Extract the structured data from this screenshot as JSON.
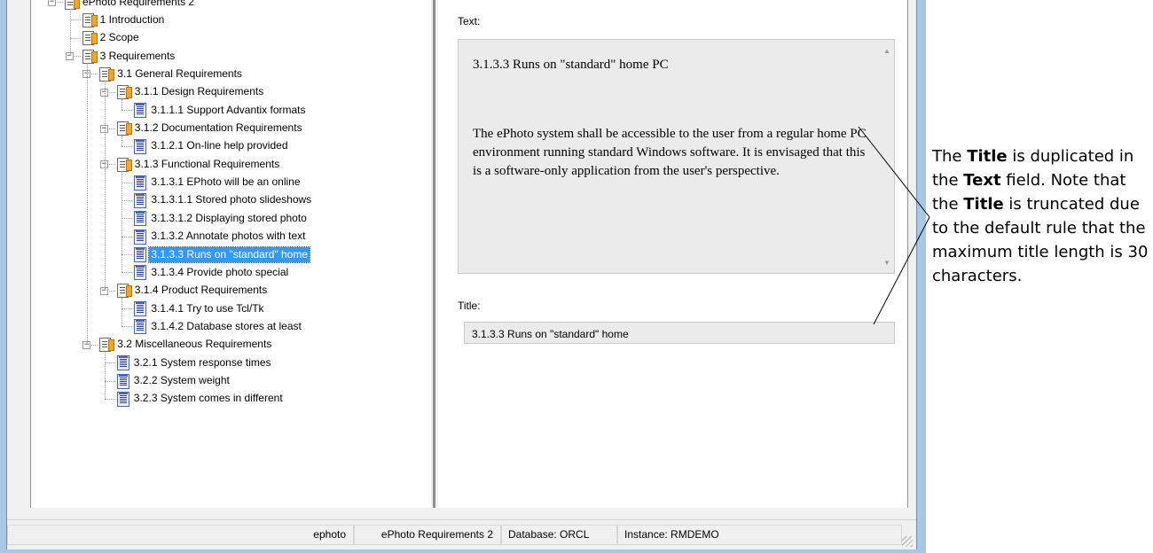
{
  "tree": {
    "items": [
      {
        "label": "ePhoto Requirements 2",
        "type": "folder"
      },
      {
        "label": "1 Introduction",
        "type": "folder"
      },
      {
        "label": "2 Scope",
        "type": "folder"
      },
      {
        "label": "3 Requirements",
        "type": "folder"
      },
      {
        "label": "3.1 General Requirements",
        "type": "folder"
      },
      {
        "label": "3.1.1 Design Requirements",
        "type": "folder"
      },
      {
        "label": "3.1.1.1 Support Advantix formats",
        "type": "requirement"
      },
      {
        "label": "3.1.2 Documentation Requirements",
        "type": "folder"
      },
      {
        "label": "3.1.2.1 On-line help provided",
        "type": "requirement"
      },
      {
        "label": "3.1.3 Functional Requirements",
        "type": "folder"
      },
      {
        "label": "3.1.3.1 EPhoto will be an online",
        "type": "requirement"
      },
      {
        "label": "3.1.3.1.1 Stored photo slideshows",
        "type": "requirement"
      },
      {
        "label": "3.1.3.1.2 Displaying stored photo",
        "type": "requirement"
      },
      {
        "label": "3.1.3.2 Annotate photos with text",
        "type": "requirement"
      },
      {
        "label": "3.1.3.3 Runs on \"standard\" home",
        "type": "requirement",
        "selected": true
      },
      {
        "label": "3.1.3.4 Provide photo special",
        "type": "requirement"
      },
      {
        "label": "3.1.4 Product Requirements",
        "type": "folder"
      },
      {
        "label": "3.1.4.1 Try to use Tcl/Tk",
        "type": "requirement"
      },
      {
        "label": "3.1.4.2 Database stores at least",
        "type": "requirement"
      },
      {
        "label": "3.2 Miscellaneous Requirements",
        "type": "folder"
      },
      {
        "label": "3.2.1 System response times",
        "type": "requirement"
      },
      {
        "label": "3.2.2 System weight",
        "type": "requirement"
      },
      {
        "label": "3.2.3 System comes in different",
        "type": "requirement"
      }
    ]
  },
  "detail": {
    "text_label": "Text:",
    "text_title": "3.1.3.3 Runs on \"standard\" home PC",
    "text_body": "The ePhoto system shall be accessible to the user from a regular home PC environment running standard Windows software. It is envisaged that this is a software-only application from the user's perspective.",
    "title_label": "Title:",
    "title_value": "3.1.3.3 Runs on \"standard\" home"
  },
  "statusbar": {
    "user": "ephoto",
    "project": "ePhoto Requirements 2",
    "database": "Database: ORCL",
    "instance": "Instance: RMDEMO"
  },
  "annotation": {
    "p1": "The ",
    "b1": "Title",
    "p2": " is duplicated in the ",
    "b2": "Text",
    "p3": " field. Note that the ",
    "b3": "Title",
    "p4": " is truncated due to the default rule that the maximum title length is 30 characters."
  },
  "colors": {
    "selection": "#3399ff",
    "window_border": "#a7c7e4",
    "folder_icon": "#f6a623",
    "requirement_icon": "#4b63b4"
  }
}
